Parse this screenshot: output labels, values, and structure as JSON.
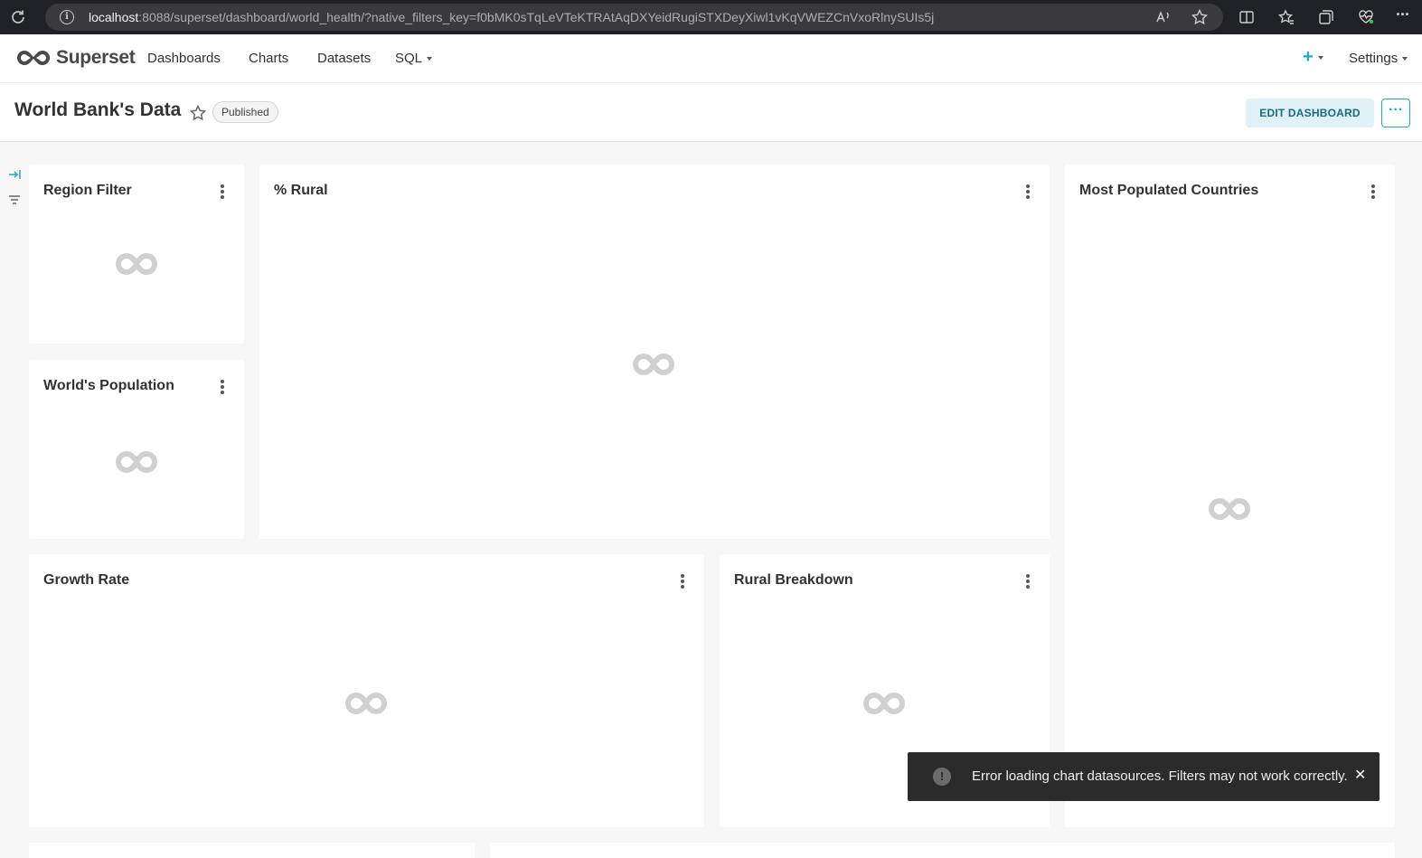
{
  "browser": {
    "url_host": "localhost",
    "url_rest": ":8088/superset/dashboard/world_health/?native_filters_key=f0bMK0sTqLeVTeKTRAtAqDXYeidRugiSTXDeyXiwl1vKqVWEZCnVxoRlnySUIs5j"
  },
  "nav": {
    "brand": "Superset",
    "dashboards": "Dashboards",
    "charts": "Charts",
    "datasets": "Datasets",
    "sql": "SQL",
    "plus": "+",
    "settings": "Settings"
  },
  "dashboard": {
    "title": "World Bank's Data",
    "status": "Published",
    "edit_button": "EDIT DASHBOARD",
    "more_button": "···"
  },
  "charts": {
    "region_filter": "Region Filter",
    "rural_pct": "% Rural",
    "most_populated": "Most Populated Countries",
    "world_population": "World's Population",
    "growth_rate": "Growth Rate",
    "rural_breakdown": "Rural Breakdown"
  },
  "toast": {
    "icon": "!",
    "message": "Error loading chart datasources. Filters may not work correctly.",
    "close": "✕"
  },
  "colors": {
    "accent": "#20a7c9",
    "toast_bg": "#2b2b2b",
    "edit_bg": "#e0f2f7"
  }
}
